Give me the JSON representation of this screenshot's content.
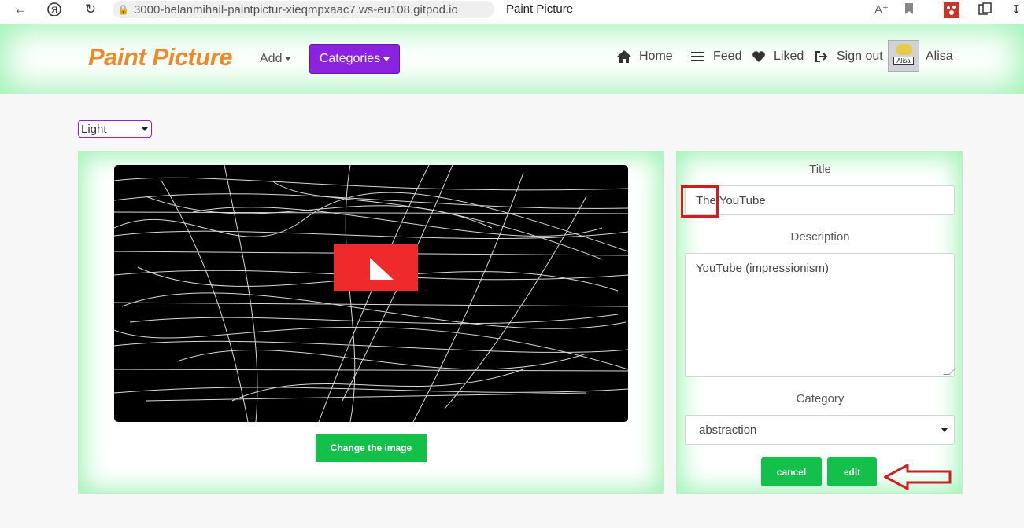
{
  "browser": {
    "url": "3000-belanmihail-paintpictur-xieqmpxaac7.ws-eu108.gitpod.io",
    "tab_title": "Paint Picture",
    "icons": [
      "back-icon",
      "yandex-icon",
      "reload-icon",
      "lock-icon",
      "translate-icon",
      "bookmark-icon",
      "extension-icon",
      "collections-icon",
      "download-icon"
    ]
  },
  "header": {
    "brand": "Paint Picture",
    "add_label": "Add",
    "categories_label": "Categories",
    "nav": {
      "home": "Home",
      "feed": "Feed",
      "liked": "Liked",
      "sign_out": "Sign out"
    },
    "avatar_tag": "Alisa",
    "user_name": "Alisa"
  },
  "theme_select": {
    "value": "Light"
  },
  "image_panel": {
    "change_button": "Change the image"
  },
  "form": {
    "title_label": "Title",
    "title_value": "The YouTube",
    "description_label": "Description",
    "description_value": "YouTube  (impressionism)",
    "category_label": "Category",
    "category_value": "abstraction",
    "cancel_button": "cancel",
    "edit_button": "edit"
  },
  "colors": {
    "brand": "#ef8a2a",
    "categories_bg": "#8b22e0",
    "action_green": "#12c04a",
    "panel_glow": "#9ff2b4",
    "annotation_red": "#d11c23"
  }
}
